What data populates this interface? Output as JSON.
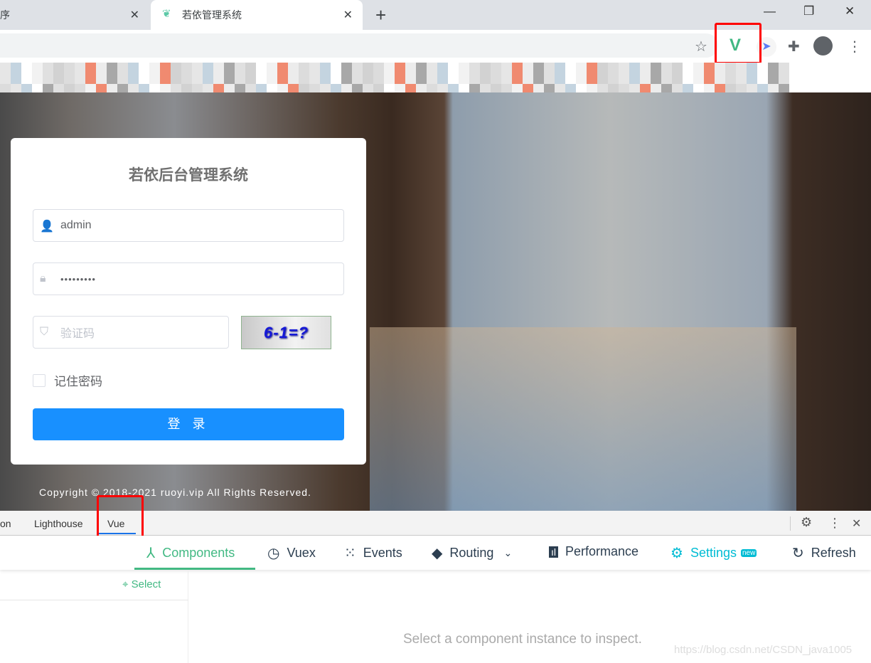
{
  "browser": {
    "tabs": [
      {
        "title": "程序"
      },
      {
        "title": "若依管理系统",
        "active": true
      }
    ],
    "new_tab": "+",
    "window": {
      "minimize": "—",
      "restore": "❐",
      "close": "✕"
    },
    "toolbar_icons": [
      "star-icon",
      "vue-devtools-icon",
      "extension-bird-icon",
      "puzzle-icon",
      "profile-icon",
      "more-icon"
    ]
  },
  "login": {
    "title": "若依后台管理系统",
    "username": "admin",
    "password": "•••••••••",
    "captcha_placeholder": "验证码",
    "captcha_image_text": "6-1=?",
    "remember_label": "记住密码",
    "login_button": "登 录",
    "copyright": "Copyright © 2018-2021 ruoyi.vip All Rights Reserved."
  },
  "devtools": {
    "tabs": [
      "on",
      "Lighthouse",
      "Vue"
    ],
    "active_tab": "Vue",
    "vue_toolbar": [
      {
        "label": "Components",
        "icon": "components-icon",
        "active": true
      },
      {
        "label": "Vuex",
        "icon": "history-icon"
      },
      {
        "label": "Events",
        "icon": "events-icon"
      },
      {
        "label": "Routing",
        "icon": "routing-icon"
      },
      {
        "label": "Performance",
        "icon": "chart-icon"
      },
      {
        "label": "Settings",
        "icon": "gear-icon",
        "badge": "new"
      },
      {
        "label": "Refresh",
        "icon": "refresh-icon"
      }
    ],
    "select_label": "Select",
    "placeholder": "Select a component instance to inspect."
  },
  "watermark": "https://blog.csdn.net/CSDN_java1005",
  "colors": {
    "primary": "#1890ff",
    "vue_green": "#42b983",
    "settings": "#00bcd4",
    "highlight": "#ff0000"
  }
}
